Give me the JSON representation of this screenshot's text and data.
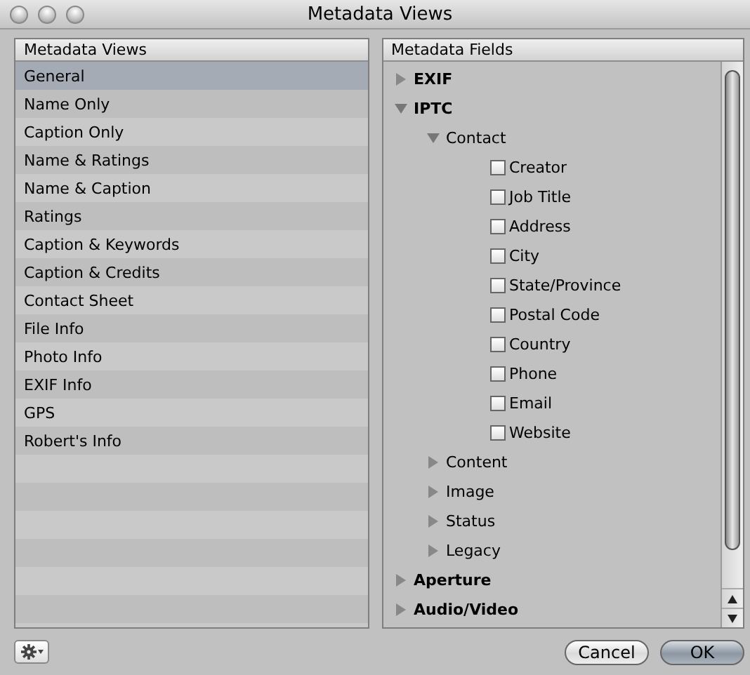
{
  "window": {
    "title": "Metadata Views"
  },
  "views": {
    "heading": "Metadata Views",
    "items": [
      {
        "label": "General",
        "selected": true
      },
      {
        "label": "Name Only",
        "selected": false
      },
      {
        "label": "Caption Only",
        "selected": false
      },
      {
        "label": "Name & Ratings",
        "selected": false
      },
      {
        "label": "Name & Caption",
        "selected": false
      },
      {
        "label": "Ratings",
        "selected": false
      },
      {
        "label": "Caption & Keywords",
        "selected": false
      },
      {
        "label": "Caption & Credits",
        "selected": false
      },
      {
        "label": "Contact Sheet",
        "selected": false
      },
      {
        "label": "File Info",
        "selected": false
      },
      {
        "label": "Photo Info",
        "selected": false
      },
      {
        "label": "EXIF Info",
        "selected": false
      },
      {
        "label": "GPS",
        "selected": false
      },
      {
        "label": "Robert's Info",
        "selected": false
      }
    ]
  },
  "fields": {
    "heading": "Metadata Fields",
    "tree": [
      {
        "kind": "group",
        "label": "EXIF",
        "expanded": false
      },
      {
        "kind": "group",
        "label": "IPTC",
        "expanded": true,
        "children": [
          {
            "kind": "group",
            "label": "Contact",
            "expanded": true,
            "children": [
              {
                "kind": "check",
                "label": "Creator",
                "checked": false
              },
              {
                "kind": "check",
                "label": "Job Title",
                "checked": false
              },
              {
                "kind": "check",
                "label": "Address",
                "checked": false
              },
              {
                "kind": "check",
                "label": "City",
                "checked": false
              },
              {
                "kind": "check",
                "label": "State/Province",
                "checked": false
              },
              {
                "kind": "check",
                "label": "Postal Code",
                "checked": false
              },
              {
                "kind": "check",
                "label": "Country",
                "checked": false
              },
              {
                "kind": "check",
                "label": "Phone",
                "checked": false
              },
              {
                "kind": "check",
                "label": "Email",
                "checked": false
              },
              {
                "kind": "check",
                "label": "Website",
                "checked": false
              }
            ]
          },
          {
            "kind": "group",
            "label": "Content",
            "expanded": false
          },
          {
            "kind": "group",
            "label": "Image",
            "expanded": false
          },
          {
            "kind": "group",
            "label": "Status",
            "expanded": false
          },
          {
            "kind": "group",
            "label": "Legacy",
            "expanded": false
          }
        ]
      },
      {
        "kind": "group",
        "label": "Aperture",
        "expanded": false
      },
      {
        "kind": "group",
        "label": "Audio/Video",
        "expanded": false
      }
    ]
  },
  "buttons": [
    {
      "label": "Cancel",
      "default": false
    },
    {
      "label": "OK",
      "default": true
    }
  ]
}
